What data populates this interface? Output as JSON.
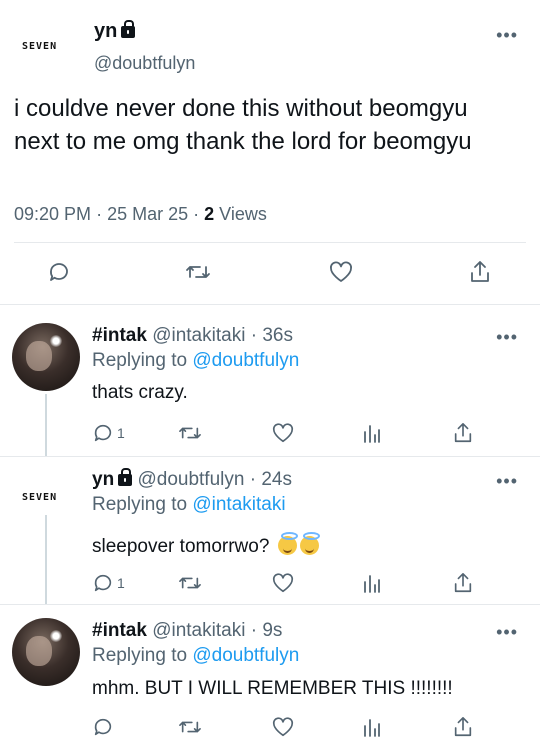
{
  "main_tweet": {
    "author_name": "yn",
    "handle": "@doubtfulyn",
    "text": "i couldve never done this without beomgyu next to me omg thank the lord for beomgyu",
    "time": "09:20 PM",
    "date": "25 Mar 25",
    "views_count": "2",
    "views_label": "Views",
    "logo_text": "SEVEN"
  },
  "replies": [
    {
      "author_name": "#intak",
      "handle": "@intakitaki",
      "time_ago": "36s",
      "replying_prefix": "Replying to",
      "replying_to": "@doubtfulyn",
      "text": "thats crazy.",
      "reply_count": "1"
    },
    {
      "author_name": "yn",
      "handle": "@doubtfulyn",
      "time_ago": "24s",
      "replying_prefix": "Replying to",
      "replying_to": "@intakitaki",
      "text": "sleepover tomorrwo?",
      "reply_count": "1",
      "logo_text": "SEVEN"
    },
    {
      "author_name": "#intak",
      "handle": "@intakitaki",
      "time_ago": "9s",
      "replying_prefix": "Replying to",
      "replying_to": "@doubtfulyn",
      "text": "mhm. BUT I WILL REMEMBER THIS !!!!!!!!",
      "reply_count": ""
    }
  ],
  "colors": {
    "accent": "#1d9bf0",
    "muted": "#536471",
    "text": "#0f1419",
    "divider": "#e6e9ec"
  },
  "icons": [
    "more-icon",
    "lock-icon",
    "reply-icon",
    "retweet-icon",
    "like-icon",
    "share-icon",
    "analytics-icon",
    "halo-emoji-icon"
  ]
}
